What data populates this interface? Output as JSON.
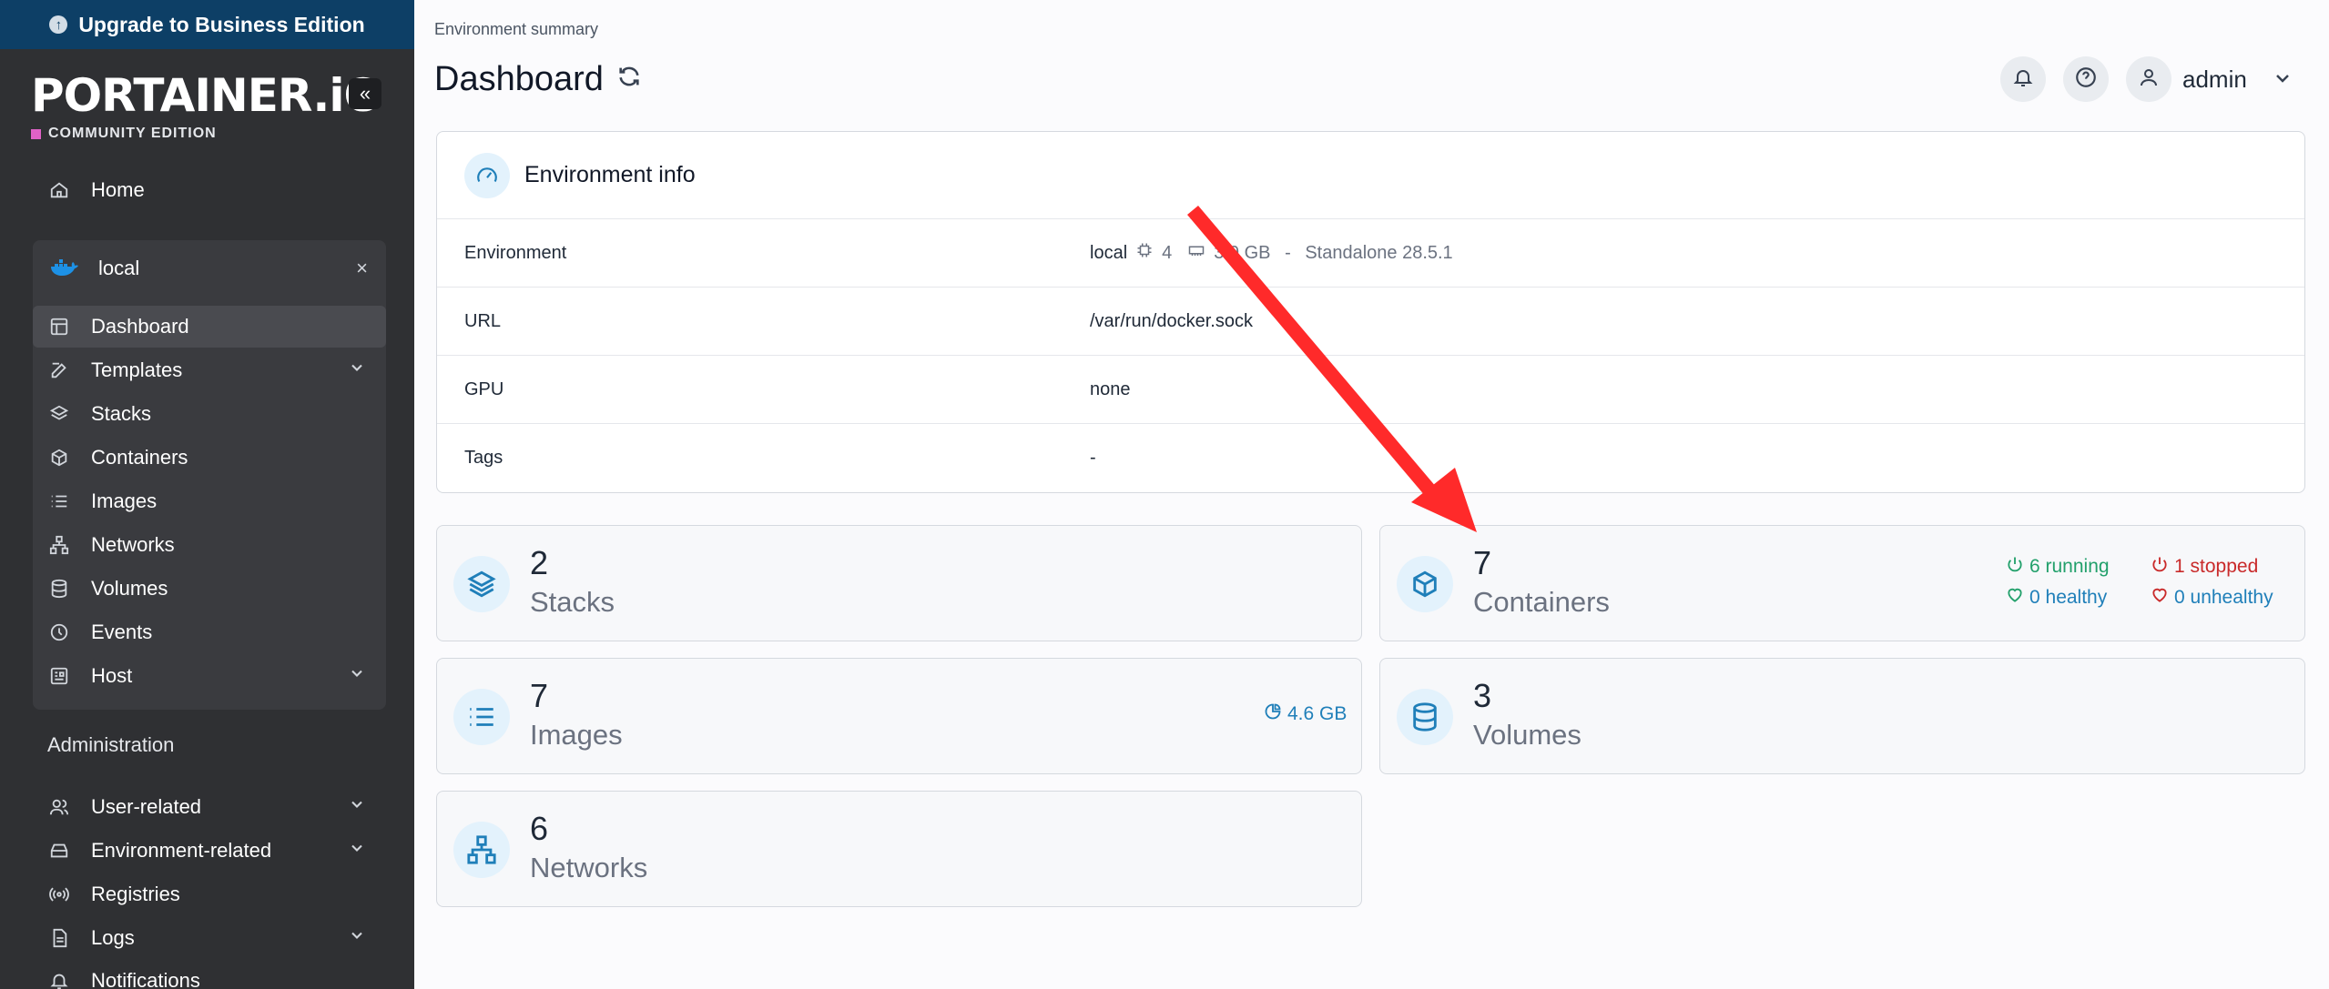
{
  "sidebar": {
    "upgrade_label": "Upgrade to Business Edition",
    "logo": "PORTAINER.iO",
    "edition": "COMMUNITY EDITION",
    "home": "Home",
    "environment": "local",
    "env_items": [
      {
        "label": "Dashboard",
        "icon": "dashboard-icon"
      },
      {
        "label": "Templates",
        "icon": "edit-icon"
      },
      {
        "label": "Stacks",
        "icon": "layers-icon"
      },
      {
        "label": "Containers",
        "icon": "box-icon"
      },
      {
        "label": "Images",
        "icon": "list-icon"
      },
      {
        "label": "Networks",
        "icon": "network-icon"
      },
      {
        "label": "Volumes",
        "icon": "database-icon"
      },
      {
        "label": "Events",
        "icon": "clock-icon"
      },
      {
        "label": "Host",
        "icon": "host-icon"
      }
    ],
    "admin_title": "Administration",
    "admin_items": [
      {
        "label": "User-related",
        "icon": "users-icon"
      },
      {
        "label": "Environment-related",
        "icon": "drive-icon"
      },
      {
        "label": "Registries",
        "icon": "radio-icon"
      },
      {
        "label": "Logs",
        "icon": "file-icon"
      },
      {
        "label": "Notifications",
        "icon": "bell-icon"
      }
    ]
  },
  "header": {
    "breadcrumb": "Environment summary",
    "title": "Dashboard",
    "user": "admin"
  },
  "env_info": {
    "title": "Environment info",
    "rows": [
      {
        "label": "Environment",
        "value": "local",
        "cpu": "4",
        "memory": "3.9 GB",
        "type": "Standalone 28.5.1"
      },
      {
        "label": "URL",
        "value": "/var/run/docker.sock"
      },
      {
        "label": "GPU",
        "value": "none"
      },
      {
        "label": "Tags",
        "value": "-"
      }
    ]
  },
  "tiles": {
    "stacks": {
      "count": "2",
      "label": "Stacks"
    },
    "containers": {
      "count": "7",
      "label": "Containers",
      "running": "6 running",
      "stopped": "1 stopped",
      "healthy": "0 healthy",
      "unhealthy": "0 unhealthy"
    },
    "images": {
      "count": "7",
      "label": "Images",
      "size": "4.6 GB"
    },
    "volumes": {
      "count": "3",
      "label": "Volumes"
    },
    "networks": {
      "count": "6",
      "label": "Networks"
    }
  },
  "colors": {
    "sidebar": "#2f3033",
    "upgrade_banner": "#0d3f66",
    "accent": "#1f7fb9",
    "running": "#22a06b",
    "stopped": "#c92a2a",
    "annotation_arrow": "#ff2a2a"
  }
}
